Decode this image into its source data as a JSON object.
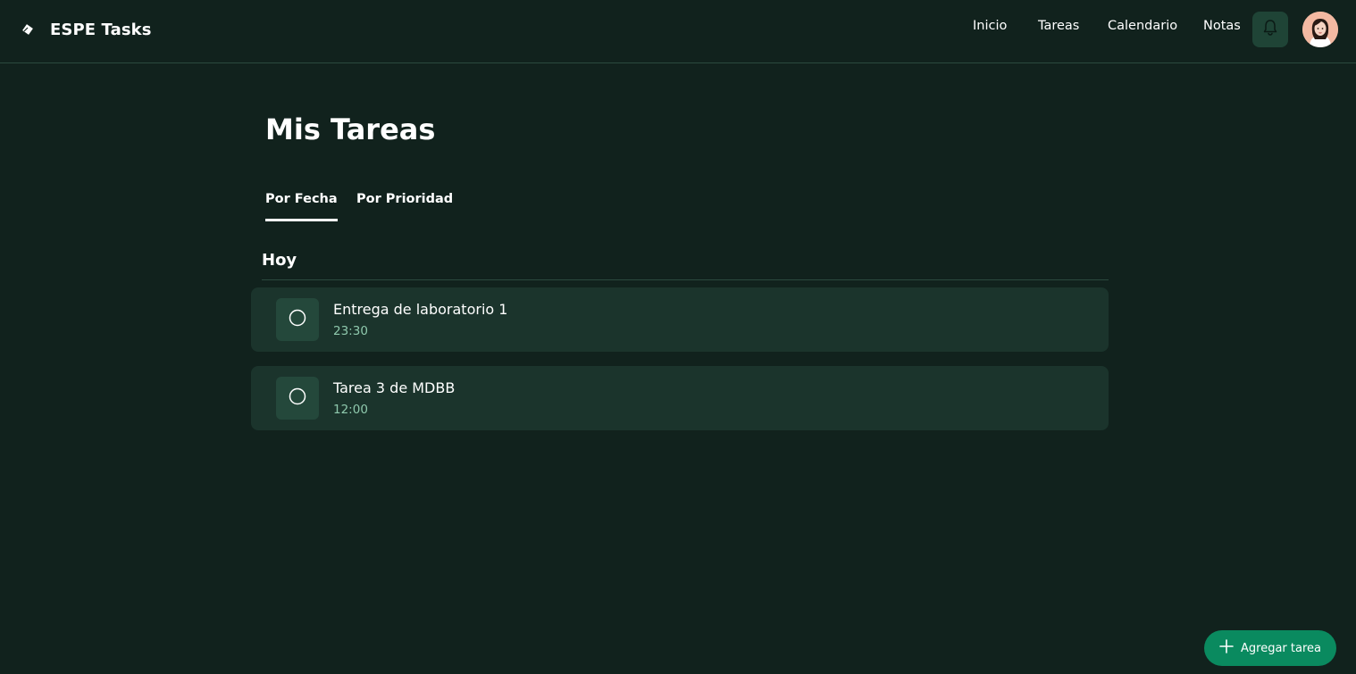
{
  "app": {
    "title": "ESPE Tasks",
    "logo_icon": "diamond-pen-icon"
  },
  "nav": {
    "items": [
      {
        "label": "Inicio"
      },
      {
        "label": "Tareas"
      },
      {
        "label": "Calendario"
      },
      {
        "label": "Notas"
      }
    ],
    "notifications_icon": "bell-icon",
    "avatar_icon": "user-avatar"
  },
  "main": {
    "page_title": "Mis Tareas",
    "tabs": [
      {
        "label": "Por Fecha",
        "active": true
      },
      {
        "label": "Por Prioridad",
        "active": false
      }
    ],
    "section_title": "Hoy",
    "tasks": [
      {
        "title": "Entrega de laboratorio 1",
        "time": "23:30",
        "completed": false
      },
      {
        "title": "Tarea 3 de MDBB",
        "time": "12:00",
        "completed": false
      }
    ]
  },
  "fab": {
    "label": "Agregar tarea",
    "icon": "plus-icon"
  },
  "colors": {
    "background": "#11221d",
    "card": "#1b342c",
    "accent": "#0a8a5f",
    "time_text": "#8fc9ad"
  }
}
